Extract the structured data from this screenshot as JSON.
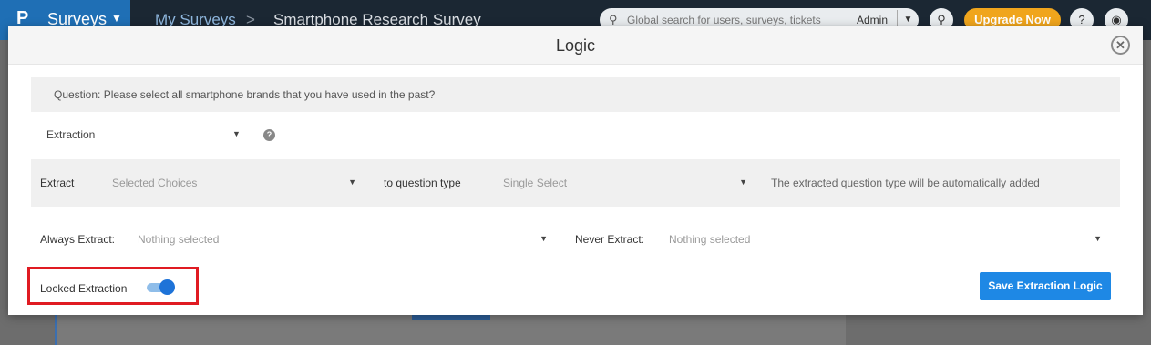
{
  "app": {
    "logo": "P",
    "product": "Surveys",
    "breadcrumbs": [
      "My Surveys",
      "Smartphone Research Survey"
    ],
    "breadcrumb_separator": ">",
    "search_placeholder": "Global search for users, surveys, tickets",
    "role": "Admin",
    "upgrade_label": "Upgrade Now",
    "help_label": "?"
  },
  "modal": {
    "title": "Logic",
    "close_icon": "close-icon",
    "question": "Question: Please select all smartphone brands that you have used in the past?",
    "logic_type": "Extraction",
    "extract": {
      "label": "Extract",
      "value": "Selected Choices",
      "to_label": "to question type",
      "to_value": "Single Select",
      "hint": "The extracted question type will be automatically added"
    },
    "always_extract": {
      "label": "Always Extract:",
      "value": "Nothing selected"
    },
    "never_extract": {
      "label": "Never Extract:",
      "value": "Nothing selected"
    },
    "locked_extraction": {
      "label": "Locked Extraction",
      "enabled": true
    },
    "save_label": "Save Extraction Logic"
  },
  "colors": {
    "primary": "#1e88e5",
    "toggle_on": "#1e73d8",
    "highlight": "#e01b22",
    "upgrade": "#f0a51c"
  }
}
